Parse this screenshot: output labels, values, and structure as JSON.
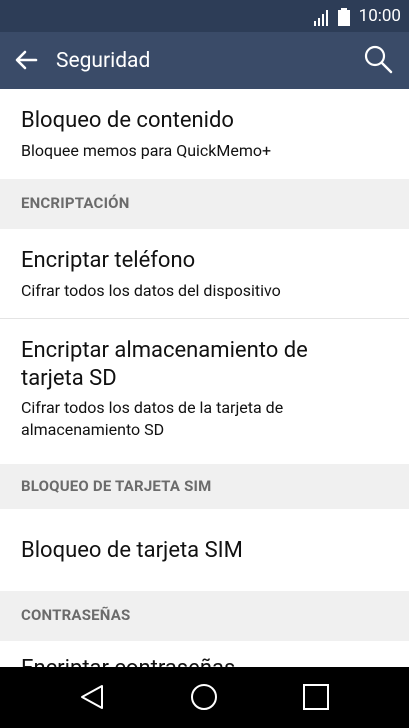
{
  "status_bar": {
    "time": "10:00"
  },
  "app_bar": {
    "title": "Seguridad",
    "back_icon": "arrow-back-icon",
    "search_icon": "search-icon"
  },
  "rows": {
    "content_lock": {
      "title": "Bloqueo de contenido",
      "subtitle": "Bloquee memos para QuickMemo+"
    },
    "encrypt_phone": {
      "title": "Encriptar teléfono",
      "subtitle": "Cifrar todos los datos del dispositivo"
    },
    "encrypt_sd": {
      "title_line1": "Encriptar almacenamiento de",
      "title_line2": "tarjeta SD",
      "subtitle_line1": "Cifrar todos los datos de la tarjeta de",
      "subtitle_line2": "almacenamiento SD"
    },
    "sim_lock": {
      "title": "Bloqueo de tarjeta SIM"
    },
    "partial_row": {
      "title": "Encriptar contraseñas"
    }
  },
  "sections": {
    "encryption": "ENCRIPTACIÓN",
    "sim_lock": "BLOQUEO DE TARJETA SIM",
    "passwords": "CONTRASEÑAS"
  },
  "nav_bar": {
    "back": "triangle-back-icon",
    "home": "circle-home-icon",
    "recents": "square-recents-icon"
  },
  "colors": {
    "status_bar": "#2d3d57",
    "app_bar": "#3a4b68",
    "section_header_bg": "#f0f0f0",
    "section_header_text": "#6b6b6b"
  }
}
